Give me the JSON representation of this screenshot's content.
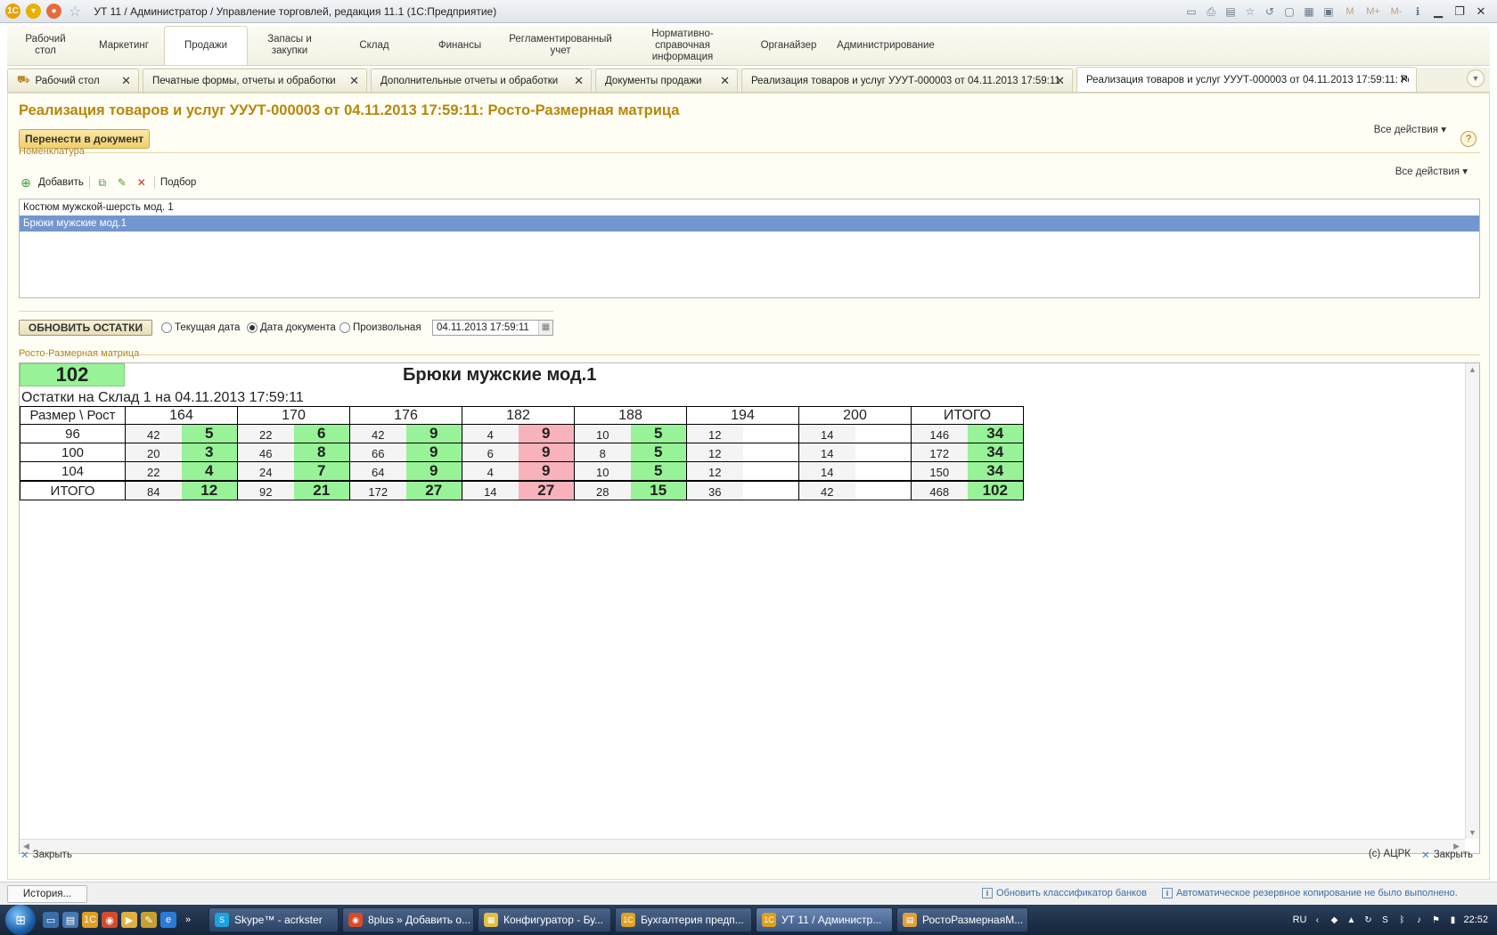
{
  "window": {
    "title": "УТ 11 / Администратор / Управление торговлей, редакция 11.1  (1С:Предприятие)",
    "toolbar_m": [
      "M",
      "M+",
      "M-"
    ]
  },
  "main_nav": [
    {
      "label": "Рабочий\nстол"
    },
    {
      "label": "Маркетинг"
    },
    {
      "label": "Продажи",
      "active": true
    },
    {
      "label": "Запасы и\nзакупки"
    },
    {
      "label": "Склад"
    },
    {
      "label": "Финансы"
    },
    {
      "label": "Регламентированный\nучет"
    },
    {
      "label": "Нормативно-справочная\nинформация"
    },
    {
      "label": "Органайзер"
    },
    {
      "label": "Администрирование"
    }
  ],
  "tabs": [
    {
      "label": "Рабочий стол"
    },
    {
      "label": "Печатные формы, отчеты и обработки"
    },
    {
      "label": "Дополнительные отчеты и обработки"
    },
    {
      "label": "Документы продажи"
    },
    {
      "label": "Реализация товаров и услуг УУУТ-000003 от 04.11.2013 17:59:11"
    },
    {
      "label": "Реализация товаров и услуг УУУТ-000003 от 04.11.2013 17:59:11: Ро...",
      "active": true
    }
  ],
  "form": {
    "title": "Реализация товаров и услуг УУУТ-000003 от 04.11.2013 17:59:11: Росто-Размерная матрица",
    "transfer_button": "Перенести в документ",
    "all_actions": "Все действия",
    "nomenclature_label": "Номенклатура",
    "add_button": "Добавить",
    "pick_button": "Подбор",
    "items": [
      {
        "name": "Костюм мужской-шерсть мод. 1"
      },
      {
        "name": "Брюки мужские мод.1",
        "selected": true
      }
    ],
    "refresh_button": "ОБНОВИТЬ ОСТАТКИ",
    "radio_current": "Текущая дата",
    "radio_document": "Дата документа",
    "radio_arbitrary": "Произвольная",
    "date_value": "04.11.2013 17:59:11",
    "matrix_label": "Росто-Размерная матрица",
    "close": "Закрыть",
    "copyright": "(c) АЦРК"
  },
  "matrix": {
    "total_badge": "102",
    "product": "Брюки мужские мод.1",
    "stock_line": "Остатки на  Склад 1  на  04.11.2013 17:59:11",
    "corner": "Размер \\ Рост",
    "heights": [
      "164",
      "170",
      "176",
      "182",
      "188",
      "194",
      "200",
      "ИТОГО"
    ],
    "rows": [
      {
        "size": "96",
        "cells": [
          [
            "42",
            "5",
            "green"
          ],
          [
            "22",
            "6",
            "green"
          ],
          [
            "42",
            "9",
            "green"
          ],
          [
            "4",
            "9",
            "red"
          ],
          [
            "10",
            "5",
            "green"
          ],
          [
            "12",
            "",
            "empty"
          ],
          [
            "14",
            "",
            "empty"
          ],
          [
            "146",
            "34",
            "green"
          ]
        ]
      },
      {
        "size": "100",
        "cells": [
          [
            "20",
            "3",
            "green"
          ],
          [
            "46",
            "8",
            "green"
          ],
          [
            "66",
            "9",
            "green"
          ],
          [
            "6",
            "9",
            "red"
          ],
          [
            "8",
            "5",
            "green"
          ],
          [
            "12",
            "",
            "empty"
          ],
          [
            "14",
            "",
            "empty"
          ],
          [
            "172",
            "34",
            "green"
          ]
        ]
      },
      {
        "size": "104",
        "cells": [
          [
            "22",
            "4",
            "green"
          ],
          [
            "24",
            "7",
            "green"
          ],
          [
            "64",
            "9",
            "green"
          ],
          [
            "4",
            "9",
            "red"
          ],
          [
            "10",
            "5",
            "green"
          ],
          [
            "12",
            "",
            "empty"
          ],
          [
            "14",
            "",
            "empty"
          ],
          [
            "150",
            "34",
            "green"
          ]
        ]
      },
      {
        "size": "ИТОГО",
        "total": true,
        "cells": [
          [
            "84",
            "12",
            "green"
          ],
          [
            "92",
            "21",
            "green"
          ],
          [
            "172",
            "27",
            "green"
          ],
          [
            "14",
            "27",
            "red"
          ],
          [
            "28",
            "15",
            "green"
          ],
          [
            "36",
            "",
            "empty"
          ],
          [
            "42",
            "",
            "empty"
          ],
          [
            "468",
            "102",
            "green"
          ]
        ]
      }
    ]
  },
  "status": {
    "history": "История...",
    "msg1": "Обновить классификатор банков",
    "msg2": "Автоматическое резервное копирование не было выполнено."
  },
  "taskbar": {
    "tasks": [
      {
        "label": "Skype™ - acrkster"
      },
      {
        "label": "8plus » Добавить о..."
      },
      {
        "label": "Конфигуратор - Бу..."
      },
      {
        "label": "Бухгалтерия предп..."
      },
      {
        "label": "УТ 11 / Администр...",
        "active": true
      },
      {
        "label": "РостоРазмернаяМ..."
      }
    ],
    "lang": "RU",
    "clock": "22:52"
  }
}
